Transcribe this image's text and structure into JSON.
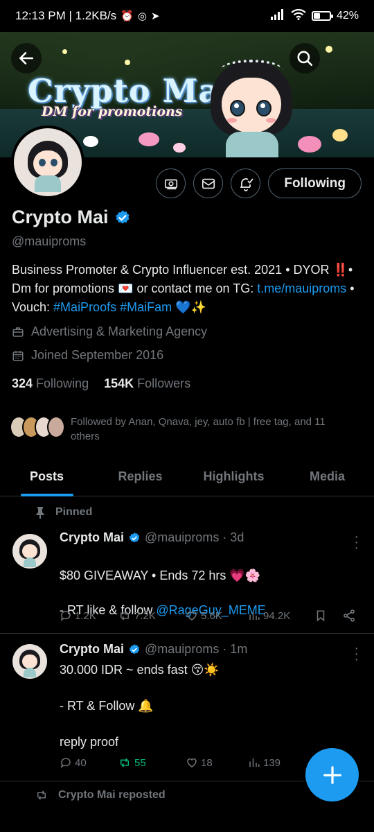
{
  "status_bar": {
    "time_net": "12:13 PM | 1.2KB/s",
    "battery": "42%",
    "battery_level": 0.42
  },
  "banner": {
    "title": "Crypto Mai",
    "subtitle": "DM for promotions"
  },
  "profile": {
    "following_button": "Following",
    "display_name": "Crypto Mai",
    "handle": "@mauiproms",
    "bio": {
      "part1": "Business Promoter & Crypto Influencer est. 2021 • DYOR ",
      "exclaim": "‼️",
      "part2": "• Dm for promotions 💌 or contact me on TG: ",
      "tg_link": "t.me/mauiproms",
      "part3": " • Vouch: ",
      "tag1": "#MaiProofs",
      "tag2": "#MaiFam",
      "emojis": " 💙✨"
    },
    "category": "Advertising & Marketing Agency",
    "joined": "Joined September 2016",
    "following_count": "324",
    "following_label": "Following",
    "followers_count": "154K",
    "followers_label": "Followers",
    "followed_by": "Followed by Anan, Qnava, jey, auto fb | free tag, and 11 others"
  },
  "tabs": [
    "Posts",
    "Replies",
    "Highlights",
    "Media"
  ],
  "pinned_label": "Pinned",
  "posts": [
    {
      "name": "Crypto Mai",
      "handle_time": "@mauiproms · 3d",
      "line1": "$80 GIVEAWAY • Ends 72 hrs 💗🌸",
      "line2_prefix": "- RT like & follow ",
      "mention": "@RageGuy_MEME",
      "replies": "1.2K",
      "reposts": "7.2K",
      "likes": "5.6K",
      "views": "94.2K"
    },
    {
      "name": "Crypto Mai",
      "handle_time": "@mauiproms · 1m",
      "text": "30.000 IDR ~ ends fast 😚☀️\n\n- RT & Follow 🔔\n\nreply proof",
      "replies": "40",
      "reposts": "55",
      "likes": "18",
      "views": "139"
    }
  ],
  "repost_label": "Crypto Mai reposted",
  "colors": {
    "accent": "#1d9bf0",
    "muted": "#71767b",
    "repost_green": "#00ba7c",
    "divider": "#2f3336"
  }
}
